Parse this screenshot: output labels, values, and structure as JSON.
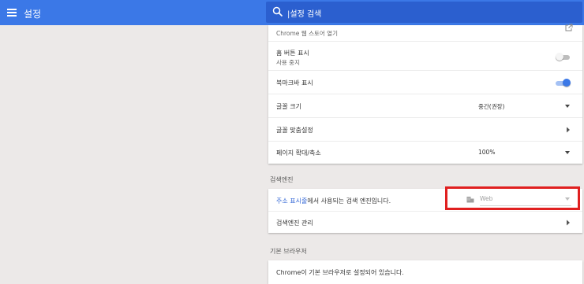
{
  "header": {
    "title": "설정",
    "search_value": "|설정 검색"
  },
  "appearance": {
    "store_sub": "Chrome 웹 스토어 열기",
    "home_button_label": "홈 버튼 표시",
    "home_button_sub": "사용 중지",
    "home_button_on": false,
    "bookmarks_bar_label": "북마크바 표시",
    "bookmarks_bar_on": true,
    "font_size_label": "글꼴 크기",
    "font_size_value": "중간(권장)",
    "customize_fonts_label": "글꼴 맞춤설정",
    "page_zoom_label": "페이지 확대/축소",
    "page_zoom_value": "100%"
  },
  "search_engine": {
    "section_title": "검색엔진",
    "desc_link": "주소 표시줄",
    "desc_rest": "에서 사용되는 검색 엔진입니다.",
    "engine_value": "Web",
    "manage_label": "검색엔진 관리"
  },
  "default_browser": {
    "section_title": "기본 브라우저",
    "status": "Chrome이 기본 브라우저로 설정되어 있습니다."
  },
  "colors": {
    "accent": "#3b78e7",
    "highlight": "#e02020"
  }
}
